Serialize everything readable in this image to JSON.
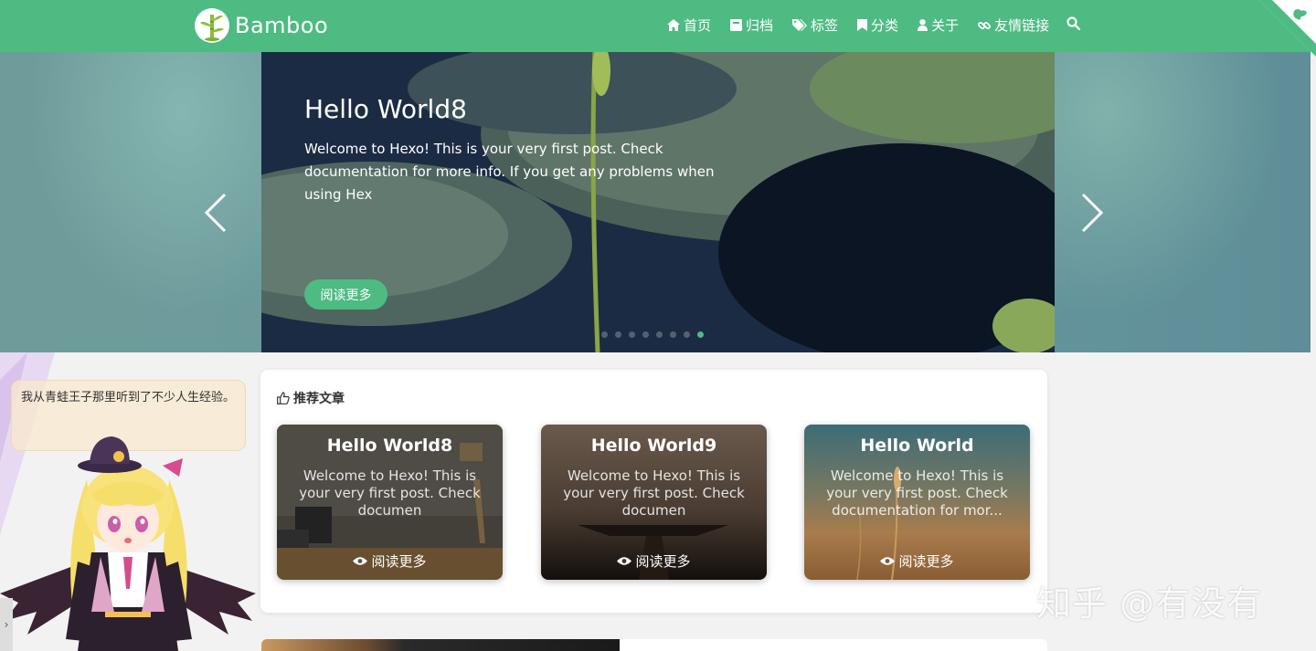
{
  "navbar": {
    "brand": "Bamboo",
    "items": [
      {
        "label": "首页",
        "icon": "home-icon"
      },
      {
        "label": "归档",
        "icon": "archive-icon"
      },
      {
        "label": "标签",
        "icon": "tags-icon"
      },
      {
        "label": "分类",
        "icon": "bookmark-icon"
      },
      {
        "label": "关于",
        "icon": "user-icon"
      },
      {
        "label": "友情链接",
        "icon": "link-icon"
      }
    ],
    "search_icon": "search-icon"
  },
  "carousel": {
    "title": "Hello World8",
    "text": "Welcome to Hexo! This is your very first post. Check documentation for more info. If you get any problems when using Hex",
    "button": "阅读更多",
    "slide_count": 8,
    "active_index": 7
  },
  "recommended": {
    "heading": "推荐文章",
    "posts": [
      {
        "title": "Hello World8",
        "text": "Welcome to Hexo! This is your very first post. Check documen",
        "more": "阅读更多"
      },
      {
        "title": "Hello World9",
        "text": "Welcome to Hexo! This is your very first post. Check documen",
        "more": "阅读更多"
      },
      {
        "title": "Hello World",
        "text": "Welcome to Hexo! This is your very first post. Check documentation for mor...",
        "more": "阅读更多"
      }
    ]
  },
  "mascot": {
    "bubble": "我从青蛙王子那里听到了不少人生经验。",
    "toggle": "›"
  },
  "watermark": "知乎 @有没有",
  "colors": {
    "accent": "#4dbb82"
  }
}
